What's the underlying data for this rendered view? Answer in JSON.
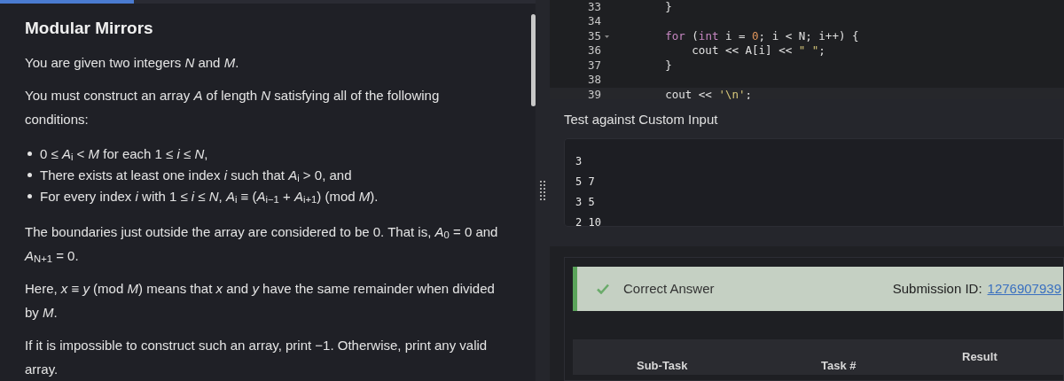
{
  "top_progress": {
    "level": 0.25
  },
  "problem": {
    "title": "Modular Mirrors",
    "blocks": [
      {
        "kind": "para",
        "text": "You are given two integers *N* and *M*."
      },
      {
        "kind": "para",
        "text": "You must construct an array *A* of length *N* satisfying all of the following conditions:"
      },
      {
        "kind": "list",
        "items": [
          "0 ≤ *A*$_{i}$ < *M* for each 1 ≤ *i* ≤ *N*,",
          "There exists at least one index *i* such that *A*$_{i}$ > 0, and",
          "For every index *i* with 1 ≤ *i* ≤ *N*, *A*$_{i}$ ≡ (*A*$_{i−1}$ + *A*$_{i+1}$)  (mod  *M*)."
        ]
      },
      {
        "kind": "para",
        "text": "The boundaries just outside the array are considered to be 0. That is, *A*$_{0}$ = 0 and *A*$_{N+1}$ = 0."
      },
      {
        "kind": "para",
        "text": "Here, *x* ≡ *y*  (mod  *M*) means that *x* and *y* have the same remainder when divided by *M*."
      },
      {
        "kind": "para",
        "text": "If it is impossible to construct such an array, print −1. Otherwise, print any valid array."
      }
    ]
  },
  "editor": {
    "lines": [
      {
        "number": "33",
        "fold": false,
        "tokens": [
          {
            "kind": "plain",
            "text": "        }"
          }
        ]
      },
      {
        "number": "34",
        "fold": false
      },
      {
        "number": "35",
        "fold": true,
        "tokens": [
          {
            "kind": "keyword",
            "text": "        for"
          },
          {
            "kind": "plain",
            "text": " ("
          },
          {
            "kind": "keyword",
            "text": "int"
          },
          {
            "kind": "plain",
            "text": " i = "
          },
          {
            "kind": "number",
            "text": "0"
          },
          {
            "kind": "plain",
            "text": "; i < N; i++) {"
          }
        ]
      },
      {
        "number": "36",
        "fold": false,
        "tokens": [
          {
            "kind": "plain",
            "text": "            cout << A[i] << "
          },
          {
            "kind": "string",
            "text": "\" \""
          },
          {
            "kind": "plain",
            "text": ";"
          }
        ]
      },
      {
        "number": "37",
        "fold": false,
        "tokens": [
          {
            "kind": "plain",
            "text": "        }"
          }
        ]
      },
      {
        "number": "38",
        "fold": false
      },
      {
        "number": "39",
        "fold": false,
        "tokens": [
          {
            "kind": "plain",
            "text": "        cout << "
          },
          {
            "kind": "string",
            "text": "'\\n'"
          },
          {
            "kind": "plain",
            "text": ";"
          }
        ]
      }
    ]
  },
  "custom_input": {
    "label": "Test against Custom Input",
    "lines": [
      "3",
      "5 7",
      "3 5",
      "2 10"
    ]
  },
  "result": {
    "status": "Correct Answer",
    "submission_label": "Submission ID:",
    "submission_id": "1276907939",
    "table_columns": [
      "Sub-Task",
      "Task #",
      "Result"
    ]
  }
}
